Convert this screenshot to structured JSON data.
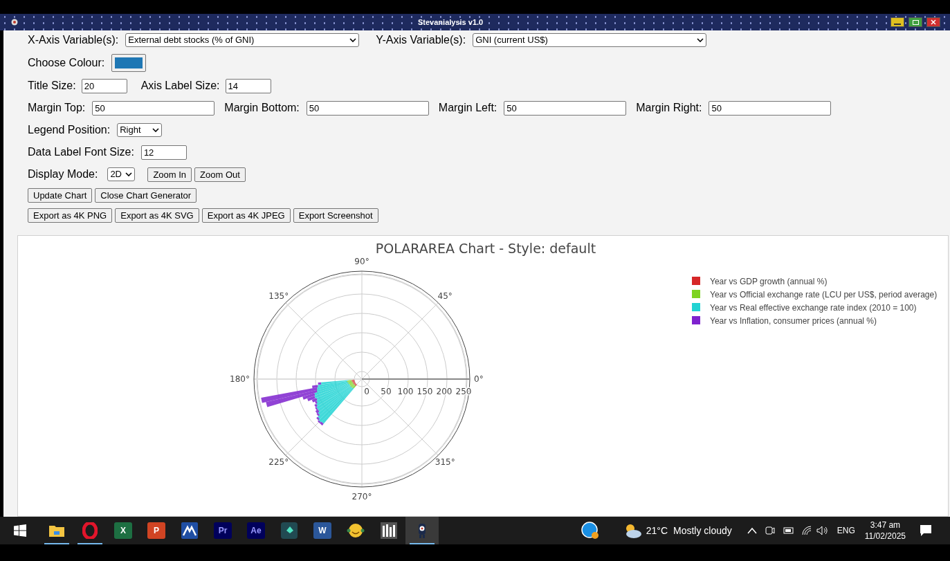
{
  "window": {
    "title": "Stevanialysis v1.0"
  },
  "form": {
    "x_axis": {
      "label": "X-Axis Variable(s):",
      "value": "External debt stocks (% of GNI)"
    },
    "y_axis": {
      "label": "Y-Axis Variable(s):",
      "value": "GNI (current US$)"
    },
    "colour": {
      "label": "Choose Colour:",
      "color": "#1f77b4"
    },
    "title_size": {
      "label": "Title Size:",
      "value": "20"
    },
    "axis_label_size": {
      "label": "Axis Label Size:",
      "value": "14"
    },
    "margins": [
      {
        "label": "Margin Top:",
        "value": "50"
      },
      {
        "label": "Margin Bottom:",
        "value": "50"
      },
      {
        "label": "Margin Left:",
        "value": "50"
      },
      {
        "label": "Margin Right:",
        "value": "50"
      }
    ],
    "legend_position": {
      "label": "Legend Position:",
      "value": "Right"
    },
    "data_label_font_size": {
      "label": "Data Label Font Size:",
      "value": "12"
    },
    "display_mode": {
      "label": "Display Mode:",
      "value": "2D"
    },
    "zoom_buttons": [
      "Zoom In",
      "Zoom Out"
    ],
    "action_buttons": [
      "Update Chart",
      "Close Chart Generator"
    ],
    "export_buttons": [
      "Export as 4K PNG",
      "Export as 4K SVG",
      "Export as 4K JPEG",
      "Export Screenshot"
    ]
  },
  "chart": {
    "title": "POLARAREA Chart - Style: default",
    "radial_labels": [
      "0",
      "50",
      "100",
      "150",
      "200",
      "250"
    ],
    "angle_labels": [
      "0°",
      "45°",
      "90°",
      "135°",
      "180°",
      "225°",
      "270°",
      "315°"
    ],
    "legend": [
      {
        "name": "Year vs GDP growth (annual %)",
        "color": "#d62728"
      },
      {
        "name": "Year vs Official exchange rate (LCU per US$, period average)",
        "color": "#7ed321"
      },
      {
        "name": "Year vs Real effective exchange rate index (2010 = 100)",
        "color": "#22d3d3"
      },
      {
        "name": "Year vs Inflation, consumer prices (annual %)",
        "color": "#7e22ce"
      }
    ]
  },
  "taskbar": {
    "apps": [
      {
        "kind": "folder",
        "running": true,
        "selected": false
      },
      {
        "kind": "opera",
        "running": true,
        "selected": false
      },
      {
        "kind": "excel",
        "glyph": "X",
        "running": false,
        "selected": false
      },
      {
        "kind": "powerpoint",
        "glyph": "P",
        "running": false,
        "selected": false
      },
      {
        "kind": "mountain",
        "running": false,
        "selected": false
      },
      {
        "kind": "premiere",
        "glyph": "Pr",
        "running": false,
        "selected": false
      },
      {
        "kind": "aftereffects",
        "glyph": "Ae",
        "running": false,
        "selected": false
      },
      {
        "kind": "filmora",
        "running": false,
        "selected": false
      },
      {
        "kind": "word",
        "glyph": "W",
        "running": false,
        "selected": false
      },
      {
        "kind": "smiley",
        "running": false,
        "selected": false
      },
      {
        "kind": "library",
        "running": false,
        "selected": false
      },
      {
        "kind": "robot",
        "running": true,
        "selected": true
      }
    ],
    "weather": {
      "temperature": "21°C",
      "condition": "Mostly cloudy"
    },
    "language": "ENG",
    "time": "3:47 am",
    "date": "11/02/2025"
  }
}
